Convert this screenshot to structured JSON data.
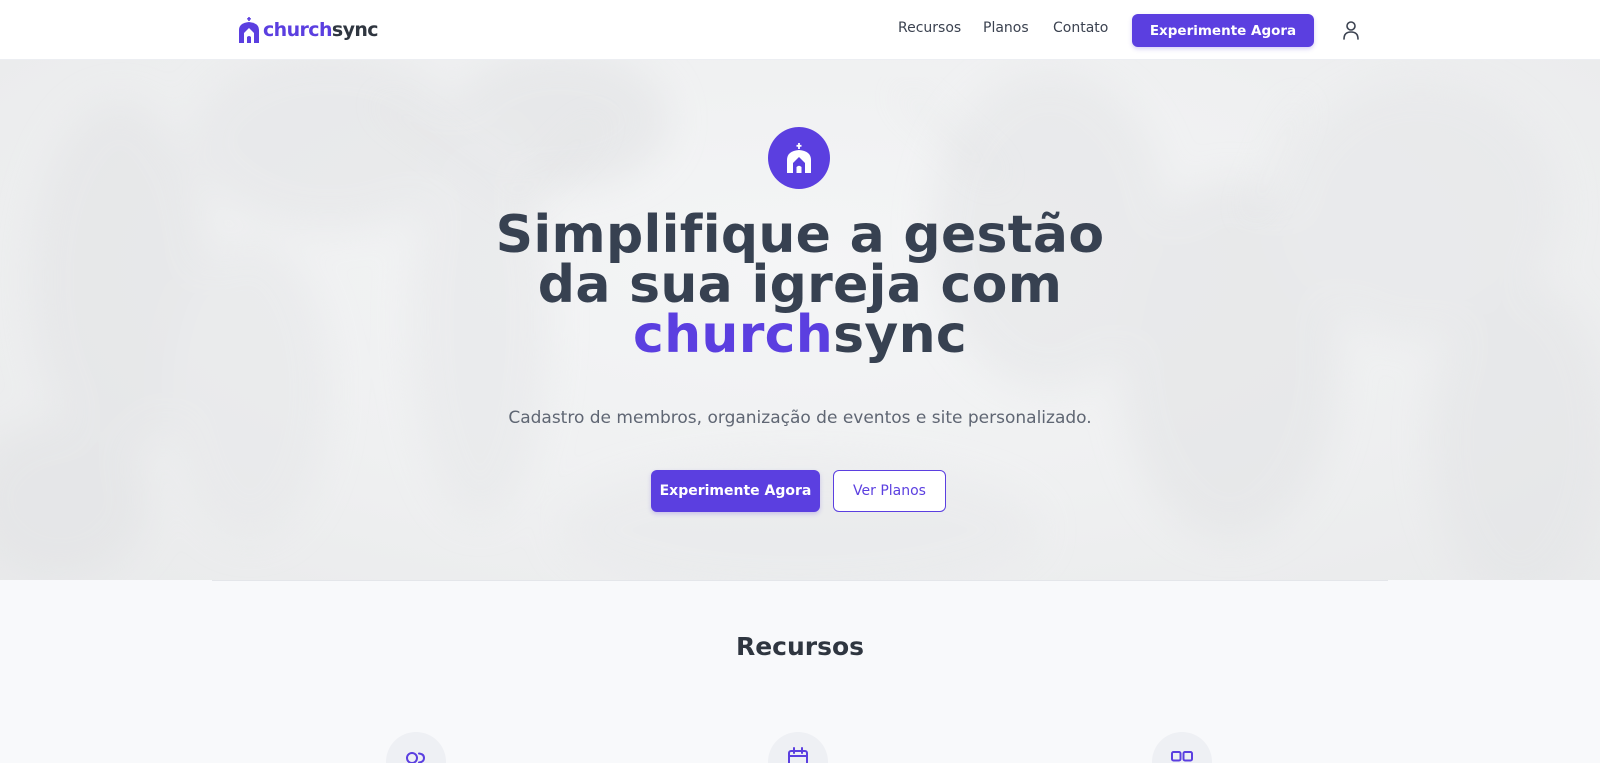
{
  "brand": {
    "part1": "church",
    "part2": "sync",
    "logo_icon": "church-icon"
  },
  "nav": {
    "links": [
      "Recursos",
      "Planos",
      "Contato"
    ],
    "cta": "Experimente Agora",
    "user_icon": "user-icon"
  },
  "hero": {
    "icon": "church-icon",
    "title_line1": "Simplifique a gestão",
    "title_line2": "da sua igreja com",
    "title_brand1": "church",
    "title_brand2": "sync",
    "subtitle": "Cadastro de membros, organização de eventos e site personalizado.",
    "cta_primary": "Experimente Agora",
    "cta_secondary": "Ver Planos"
  },
  "features": {
    "title": "Recursos",
    "icons": [
      "members-icon",
      "calendar-icon",
      "website-icon"
    ]
  },
  "colors": {
    "accent": "#5b3fe0",
    "text_dark": "#374151",
    "page_bg": "#f8f9fb"
  }
}
